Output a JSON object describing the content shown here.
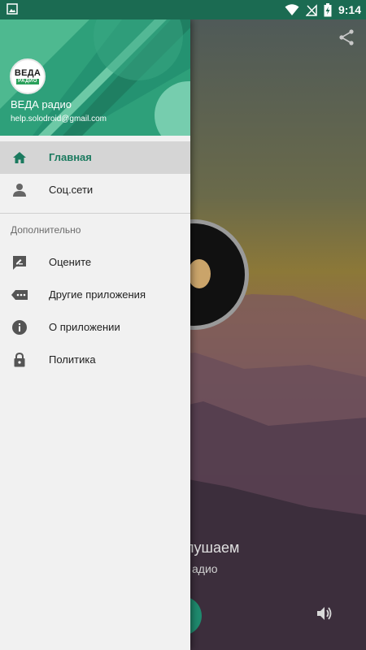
{
  "statusbar": {
    "time": "9:14",
    "icons": [
      "image-notification-icon",
      "wifi-icon",
      "no-signal-icon",
      "battery-charging-icon"
    ]
  },
  "background_screen": {
    "now_playing_title_partial": "лушаем",
    "now_playing_subtitle_partial": "адио",
    "share_icon": "share-icon",
    "volume_icon": "volume-icon"
  },
  "drawer": {
    "header": {
      "logo_text": "ВЕДА",
      "logo_subtext": "РАДИО",
      "app_name": "ВЕДА радио",
      "email": "help.solodroid@gmail.com"
    },
    "main_items": [
      {
        "label": "Главная",
        "icon": "home-icon",
        "active": true
      },
      {
        "label": "Соц.сети",
        "icon": "person-icon",
        "active": false
      }
    ],
    "section_title": "Дополнительно",
    "extra_items": [
      {
        "label": "Оцените",
        "icon": "rate-icon"
      },
      {
        "label": "Другие приложения",
        "icon": "more-apps-icon"
      },
      {
        "label": "О приложении",
        "icon": "info-icon"
      },
      {
        "label": "Политика",
        "icon": "lock-icon"
      }
    ]
  },
  "colors": {
    "primary": "#1b7a5f",
    "header_green": "#2ea07a",
    "statusbar": "#1b6b52",
    "active_item_bg": "#d5d5d5"
  }
}
